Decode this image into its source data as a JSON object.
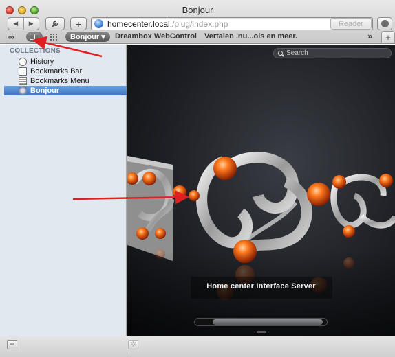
{
  "window": {
    "title": "Bonjour"
  },
  "toolbar": {
    "back_icon": "back-arrow-icon",
    "forward_icon": "forward-arrow-icon",
    "add_bookmark_label": "+",
    "url_host": "homecenter.local.",
    "url_path": "/plug/index.php",
    "reader_label": "Reader"
  },
  "bookmarks_bar": {
    "folder_label": "Bonjour ▾",
    "link1": "Dreambox WebControl",
    "link2": "Vertalen .nu...ols en meer.",
    "more_label": "»",
    "new_tab_label": "+"
  },
  "sidebar": {
    "heading": "COLLECTIONS",
    "items": [
      {
        "label": "History",
        "icon": "clock-icon"
      },
      {
        "label": "Bookmarks Bar",
        "icon": "book-icon"
      },
      {
        "label": "Bookmarks Menu",
        "icon": "menu-list-icon"
      },
      {
        "label": "Bonjour",
        "icon": "bonjour-icon",
        "selected": true
      }
    ]
  },
  "content": {
    "search_placeholder": "Search",
    "caption": "Home center Interface Server"
  },
  "bottombar": {
    "add_label": "+",
    "settings_icon": "gear-icon"
  },
  "colors": {
    "selection": "#3c74c3",
    "sidebar_bg": "#e2e8f0",
    "annotation_arrow": "#e02020",
    "orb": "#e8520f"
  }
}
